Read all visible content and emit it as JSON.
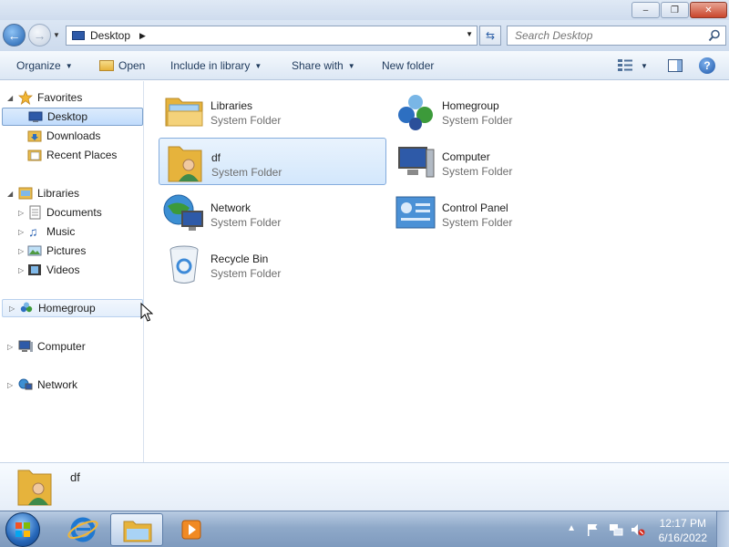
{
  "window": {
    "minimize_label": "–",
    "maximize_label": "❐",
    "close_label": "✕"
  },
  "address": {
    "location": "Desktop",
    "separator": "▶",
    "search_placeholder": "Search Desktop"
  },
  "toolbar": {
    "organize": "Organize",
    "open": "Open",
    "include_in_library": "Include in library",
    "share_with": "Share with",
    "new_folder": "New folder",
    "help": "?"
  },
  "nav": {
    "favorites": "Favorites",
    "favorites_items": [
      "Desktop",
      "Downloads",
      "Recent Places"
    ],
    "libraries": "Libraries",
    "library_items": [
      "Documents",
      "Music",
      "Pictures",
      "Videos"
    ],
    "homegroup": "Homegroup",
    "computer": "Computer",
    "network": "Network"
  },
  "items": [
    {
      "name": "Libraries",
      "type": "System Folder",
      "icon": "libraries-icon"
    },
    {
      "name": "Homegroup",
      "type": "System Folder",
      "icon": "homegroup-icon"
    },
    {
      "name": "df",
      "type": "System Folder",
      "icon": "user-folder-icon"
    },
    {
      "name": "Computer",
      "type": "System Folder",
      "icon": "computer-icon"
    },
    {
      "name": "Network",
      "type": "System Folder",
      "icon": "network-icon"
    },
    {
      "name": "Control Panel",
      "type": "System Folder",
      "icon": "control-panel-icon"
    },
    {
      "name": "Recycle Bin",
      "type": "System Folder",
      "icon": "recycle-bin-icon"
    }
  ],
  "details": {
    "selected_name": "df"
  },
  "taskbar": {
    "time": "12:17 PM",
    "date": "6/16/2022"
  },
  "colors": {
    "selection_fill": "#d3e7fc",
    "selection_border": "#84acdd",
    "taskbar": "#8fa9c9"
  }
}
